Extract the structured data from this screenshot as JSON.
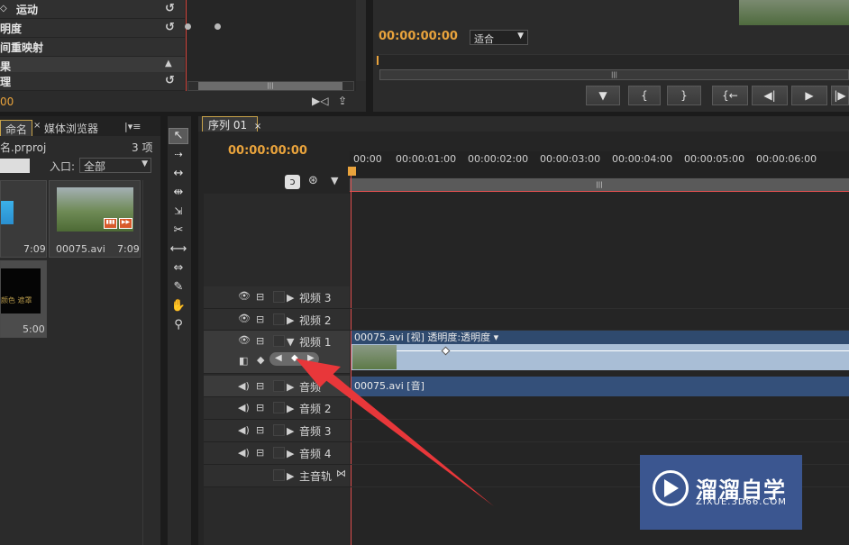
{
  "effect_controls": {
    "rows": [
      {
        "label": "运动",
        "reset_icon": "reset-icon"
      },
      {
        "label": "明度",
        "reset_icon": "reset-icon"
      },
      {
        "label": "间重映射"
      },
      {
        "label": "果"
      },
      {
        "label": "理",
        "reset_icon": "reset-icon"
      }
    ],
    "timecode": "00",
    "scrollbar_grip": "|||"
  },
  "program_monitor": {
    "timecode": "00:00:00:00",
    "fit_select": "适合",
    "transport_buttons": [
      {
        "icon": "marker-icon",
        "glyph": "▼"
      },
      {
        "icon": "mark-in-icon",
        "glyph": "{"
      },
      {
        "icon": "mark-out-icon",
        "glyph": "}"
      },
      {
        "icon": "go-to-in-icon",
        "glyph": "{←"
      },
      {
        "icon": "step-back-icon",
        "glyph": "◀|"
      },
      {
        "icon": "play-icon",
        "glyph": "▶"
      },
      {
        "icon": "step-forward-icon",
        "glyph": "|▶"
      }
    ],
    "scrollbar_grip": "|||"
  },
  "project": {
    "tabs": [
      "命名",
      "媒体浏览器"
    ],
    "tab_menu": "|▾≡",
    "file_name": "名.prproj",
    "item_count": "3 项",
    "in_label": "入口:",
    "in_select": "全部",
    "clips": [
      {
        "name": "",
        "duration": "7:09"
      },
      {
        "name": "00075.avi",
        "duration": "7:09"
      },
      {
        "name": "",
        "duration": "5:00",
        "overlay": "颜色 遮罩"
      }
    ]
  },
  "timeline": {
    "tab_label": "序列 01",
    "timecode": "00:00:00:00",
    "ruler": [
      "00:00",
      "00:00:01:00",
      "00:00:02:00",
      "00:00:03:00",
      "00:00:04:00",
      "00:00:05:00",
      "00:00:06:00"
    ],
    "tracks": [
      {
        "name": "视频 3",
        "kind": "video"
      },
      {
        "name": "视频 2",
        "kind": "video"
      },
      {
        "name": "视频 1",
        "kind": "video",
        "expanded": true
      },
      {
        "name": "音频",
        "kind": "audio"
      },
      {
        "name": "音频 2",
        "kind": "audio"
      },
      {
        "name": "音频 3",
        "kind": "audio"
      },
      {
        "name": "音频 4",
        "kind": "audio"
      },
      {
        "name": "主音轨",
        "kind": "master"
      }
    ],
    "video_clip_label": "00075.avi [视] 透明度:透明度 ▾",
    "audio_clip_label": "00075.avi [音]",
    "work_grip": "|||"
  },
  "watermark": {
    "title": "溜溜自学",
    "url": "ZIXUE.3D66.COM"
  },
  "colors": {
    "timecode": "#e9a33c",
    "playhead": "#e05050",
    "arrow": "#e8373a",
    "watermark_bg": "#3b5690"
  }
}
